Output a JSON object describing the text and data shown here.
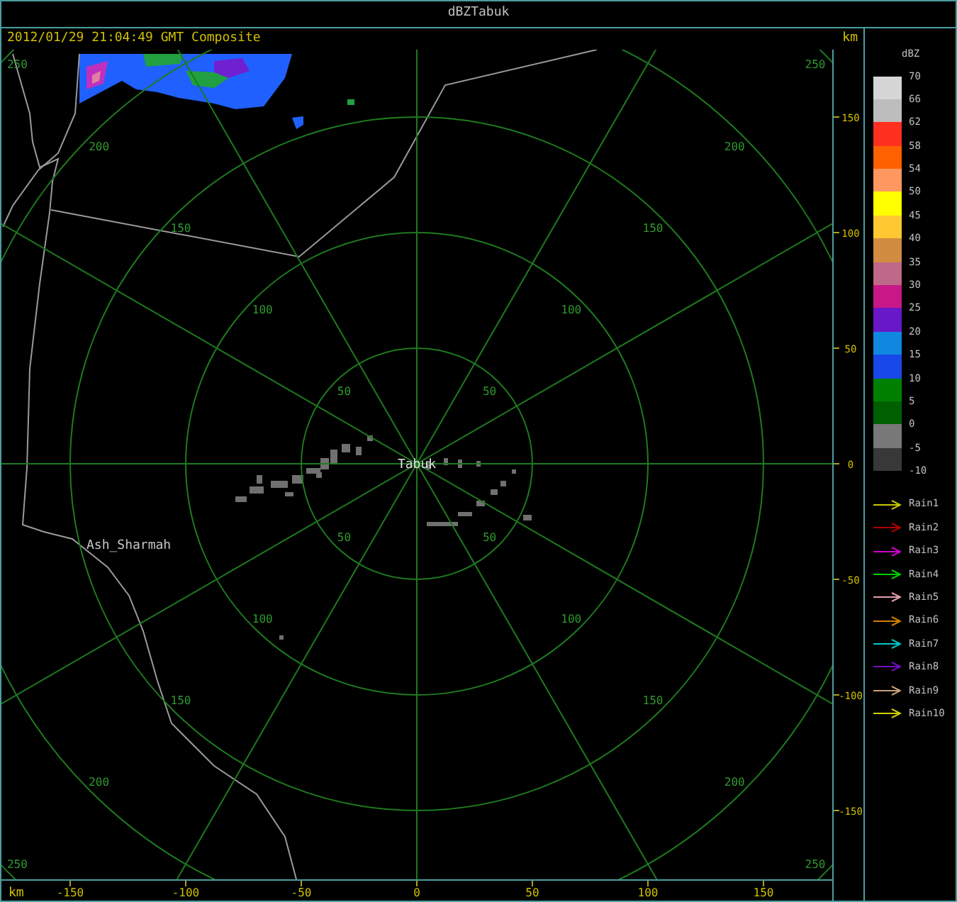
{
  "window": {
    "title": "dBZTabuk"
  },
  "header": {
    "timestamp": "2012/01/29 21:04:49 GMT Composite",
    "unit": "km"
  },
  "map": {
    "station": "Tabuk",
    "places": [
      "Ash_Sharmah"
    ],
    "rings": [
      {
        "labels": [
          "50",
          "50",
          "50",
          "50"
        ]
      },
      {
        "labels": [
          "100",
          "100",
          "100",
          "100"
        ]
      },
      {
        "labels": [
          "150",
          "150",
          "150",
          "150"
        ]
      },
      {
        "labels": [
          "200",
          "200",
          "200",
          "200"
        ]
      },
      {
        "labels": [
          "250",
          "250",
          "250",
          "250"
        ]
      }
    ]
  },
  "y_axis": {
    "ticks": [
      "150",
      "100",
      "50",
      "0",
      "-50",
      "-100",
      "-150"
    ]
  },
  "x_axis": {
    "unit": "km",
    "ticks": [
      "-150",
      "-100",
      "-50",
      "0",
      "50",
      "100",
      "150"
    ]
  },
  "legend": {
    "title": "dBZ",
    "labels": [
      "70",
      "66",
      "62",
      "58",
      "54",
      "50",
      "45",
      "40",
      "35",
      "30",
      "25",
      "20",
      "15",
      "10",
      "5",
      "0",
      "-5",
      "-10"
    ],
    "bins": [
      {
        "color": "#d6d6d6"
      },
      {
        "color": "#bdbdbd"
      },
      {
        "color": "#ff3020"
      },
      {
        "color": "#ff6000"
      },
      {
        "color": "#ff9860"
      },
      {
        "color": "#ffff00"
      },
      {
        "color": "#ffc830"
      },
      {
        "color": "#d08c40"
      },
      {
        "color": "#c06888"
      },
      {
        "color": "#c81888"
      },
      {
        "color": "#6818c8"
      },
      {
        "color": "#1088e0"
      },
      {
        "color": "#1848e8"
      },
      {
        "color": "#008000"
      },
      {
        "color": "#006000"
      },
      {
        "color": "#787878"
      },
      {
        "color": "#383838"
      }
    ]
  },
  "arrows": [
    {
      "label": "Rain1",
      "color": "#c8c800"
    },
    {
      "label": "Rain2",
      "color": "#b00000"
    },
    {
      "label": "Rain3",
      "color": "#d000d0"
    },
    {
      "label": "Rain4",
      "color": "#00d000"
    },
    {
      "label": "Rain5",
      "color": "#e0a0a8"
    },
    {
      "label": "Rain6",
      "color": "#d08000"
    },
    {
      "label": "Rain7",
      "color": "#00c8c8"
    },
    {
      "label": "Rain8",
      "color": "#7010c0"
    },
    {
      "label": "Rain9",
      "color": "#c8a078"
    },
    {
      "label": "Rain10",
      "color": "#d0d000"
    }
  ]
}
